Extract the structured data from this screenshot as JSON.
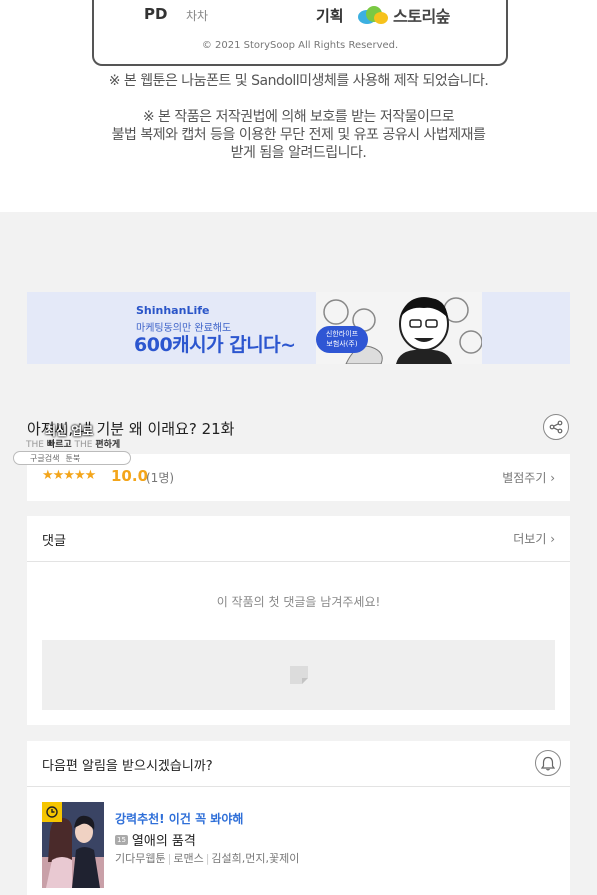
{
  "credits": {
    "pd_label": "PD",
    "pd_value": "차차",
    "plan_label": "기획",
    "plan_logo_text": "스토리숲",
    "copyright": "© 2021 StorySoop All Rights Reserved."
  },
  "notices": {
    "font_notice": "※ 본 웹툰은 나눔폰트 및 Sandoll미생체를 사용해 제작 되었습니다.",
    "copyright_lines": [
      "※ 본 작품은 저작권법에 의해 보호를 받는 저작물이므로",
      "불법 복제와 캡처 등을 이용한 무단 전제 및 유포 공유시 사법제재를",
      "받게 됨을 알려드립니다."
    ]
  },
  "ad": {
    "brand": "ShinhanLife",
    "subline": "마케팅동의만 완료해도",
    "headline": "600캐시가 갑니다~",
    "tag_lines": [
      "신한라이프",
      "보험사(주)"
    ]
  },
  "episode": {
    "title": "아저씨, 내 기분 왜 이래요? 21화"
  },
  "overlay": {
    "line1": "최신 업로",
    "line2_prefix": "THE",
    "line2_a": "빠르고",
    "line2_mid": "THE",
    "line2_b": "편하게",
    "search_a": "구글검색",
    "search_b": "툰북"
  },
  "rating": {
    "stars": "★★★★★",
    "score": "10.0",
    "count": "(1명)",
    "rate_link": "별점주기 ›"
  },
  "comments": {
    "title": "댓글",
    "more": "더보기 ›",
    "empty_message": "이 작품의 첫 댓글을 남겨주세요!"
  },
  "next_episode": {
    "question": "다음편 알림을 받으시겠습니까?"
  },
  "recommendation": {
    "label": "강력추천! 이건 꼭 봐야해",
    "badge": "15",
    "title": "열애의 품격",
    "meta": [
      "기다무웹툰",
      "로맨스",
      "김설희,먼지,꽃제이"
    ]
  },
  "colors": {
    "accent_orange": "#f3a51b",
    "accent_blue": "#2f6fd8",
    "background": "#f2f2f2"
  }
}
